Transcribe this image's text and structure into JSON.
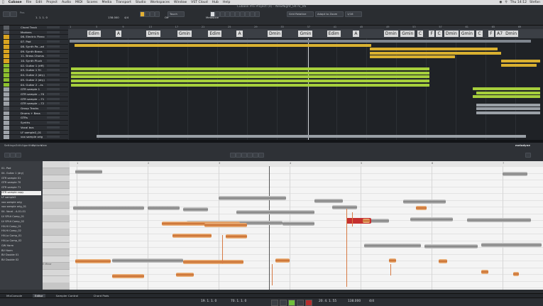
{
  "menubar": {
    "app": "Cubase",
    "items": [
      "File",
      "Edit",
      "Project",
      "Audio",
      "MIDI",
      "Scores",
      "Media",
      "Transport",
      "Studio",
      "Workspaces",
      "Window",
      "VST Cloud",
      "Hub",
      "Help"
    ],
    "clock": "Thu 14:12",
    "user": "Stefan"
  },
  "window": {
    "title": "Cubase Pro Project (4) - NewNight_04 hi_06"
  },
  "toolbar": {
    "snap_mode": "Touch",
    "grid_label": "Grid Relative",
    "quantize_label": "Adapt to Zoom",
    "quantize_value": "1/16",
    "position": "1. 1. 1. 0",
    "tempo": "138.000",
    "signature": "4/4",
    "key": "Off",
    "range": "Metaslice"
  },
  "tracks": [
    {
      "name": "Chord Track",
      "color": "#5a5e64"
    },
    {
      "name": "Markers",
      "color": "#5a5e64"
    },
    {
      "name": "06. Electric Piano",
      "color": "#d9a420"
    },
    {
      "name": "07. Pad",
      "color": "#d9a420"
    },
    {
      "name": "08. Synth Pa...ad",
      "color": "#d9a420"
    },
    {
      "name": "09. Synth Brass",
      "color": "#d9a420"
    },
    {
      "name": "11. Brass Chorus",
      "color": "#d9a420"
    },
    {
      "name": "10. Synth Pluck",
      "color": "#d9a420"
    },
    {
      "name": "02. Guitar 1 (riff)",
      "color": "#8cbf2e"
    },
    {
      "name": "03. Guitar 1 Tri",
      "color": "#8cbf2e"
    },
    {
      "name": "04. Guitar 2 (dry)",
      "color": "#8cbf2e"
    },
    {
      "name": "05. Guitar 2 (dry)",
      "color": "#8cbf2e"
    },
    {
      "name": "04. Guitar 2 ...ts",
      "color": "#8cbf2e"
    },
    {
      "name": "GTR sample 1",
      "color": "#9da2a8"
    },
    {
      "name": "GTR sample ...70",
      "color": "#9da2a8"
    },
    {
      "name": "GTR sample ...71",
      "color": "#9da2a8"
    },
    {
      "name": "GTR sample ...72",
      "color": "#9da2a8"
    },
    {
      "name": "Group Tracks",
      "color": "#5a5e64"
    },
    {
      "name": "Drums + Bass",
      "color": "#9da2a8"
    },
    {
      "name": "GTRs",
      "color": "#9da2a8"
    },
    {
      "name": "Synths",
      "color": "#9da2a8"
    },
    {
      "name": "Vocal bus",
      "color": "#9da2a8"
    },
    {
      "name": "LF sample2_01",
      "color": "#9da2a8"
    },
    {
      "name": "vox sample orig",
      "color": "#9da2a8"
    }
  ],
  "ruler_marks": [
    "1",
    "5",
    "9",
    "13",
    "17",
    "21",
    "25",
    "29",
    "33",
    "37",
    "41",
    "45",
    "49",
    "53",
    "57",
    "61",
    "65",
    "69"
  ],
  "chords": [
    {
      "label": "Edim",
      "pos": 0.04
    },
    {
      "label": "A",
      "pos": 0.1
    },
    {
      "label": "Dmin",
      "pos": 0.165
    },
    {
      "label": "Gmin",
      "pos": 0.23
    },
    {
      "label": "Edim",
      "pos": 0.295
    },
    {
      "label": "A",
      "pos": 0.355
    },
    {
      "label": "Dmin",
      "pos": 0.42
    },
    {
      "label": "Gmin",
      "pos": 0.485
    },
    {
      "label": "Edim",
      "pos": 0.545
    },
    {
      "label": "A",
      "pos": 0.6
    },
    {
      "label": "Dmin",
      "pos": 0.665
    },
    {
      "label": "Gmin",
      "pos": 0.7
    },
    {
      "label": "C",
      "pos": 0.735
    },
    {
      "label": "F",
      "pos": 0.76
    },
    {
      "label": "C",
      "pos": 0.775
    },
    {
      "label": "Dmin",
      "pos": 0.792
    },
    {
      "label": "Gmin",
      "pos": 0.825
    },
    {
      "label": "C",
      "pos": 0.86
    },
    {
      "label": "F",
      "pos": 0.885
    },
    {
      "label": "A7",
      "pos": 0.9
    },
    {
      "label": "Dmin",
      "pos": 0.918
    }
  ],
  "melodyne": {
    "menus": [
      "Settings",
      "Edit",
      "Algorithm",
      "Options",
      "View"
    ],
    "brand": "melodyne",
    "list": [
      "01. Pad",
      "04. Guitar 1 (dry)",
      "GTR sample 01",
      "GTR sample 70",
      "GTR sample 71",
      "GTR sample copy",
      "LF sample2",
      "vox sample orig",
      "vox sample orig_01",
      "04. Vocal - A-01-01",
      "LV SPLit Comp_01",
      "LV SPLit Comp_02",
      "HV-Hi Comp_01",
      "HV-Hi Comp_02",
      "HV-Lo Comp_01",
      "HV-Lo Comp_02",
      "GW Harm",
      "BV Harm",
      "BV Double 01",
      "BV Double 02"
    ],
    "selected_index": 5,
    "keys": [
      "",
      "",
      "",
      "",
      "",
      "",
      "",
      "",
      "",
      "",
      "",
      "",
      "",
      "",
      "",
      "E Minor",
      "",
      "",
      ""
    ],
    "ruler": [
      "1",
      "2",
      "3",
      "4",
      "5",
      "6",
      "7"
    ]
  },
  "lower_zone_tabs": [
    {
      "label": "MixConsole",
      "active": false
    },
    {
      "label": "Editor",
      "active": true
    },
    {
      "label": "Sampler Control",
      "active": false
    },
    {
      "label": "Chord Pads",
      "active": false
    }
  ],
  "transport": {
    "left_locator": "19. 1. 1. 0",
    "right_locator": "70. 1. 1. 0",
    "position": "20. 4. 1. 55",
    "tempo": "138.000",
    "signature": "4/4"
  }
}
